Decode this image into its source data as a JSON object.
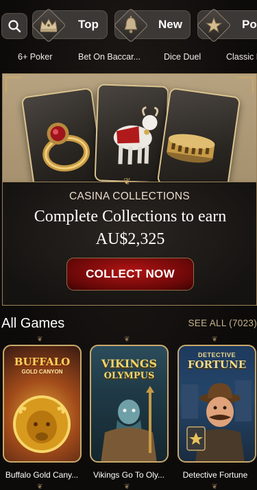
{
  "filters": {
    "search_icon": "search-icon",
    "chips": [
      {
        "label": "Top",
        "icon": "crown-icon"
      },
      {
        "label": "New",
        "icon": "bell-icon"
      },
      {
        "label": "Po",
        "icon": "star-icon"
      }
    ]
  },
  "categories": [
    "6+ Poker",
    "Bet On Baccar...",
    "Dice Duel",
    "Classic P"
  ],
  "banner": {
    "subtitle": "CASINA COLLECTIONS",
    "title": "Complete Collections to earn AU$2,325",
    "button": "COLLECT NOW"
  },
  "games_section": {
    "title": "All Games",
    "see_all": "SEE ALL (7023)",
    "games": [
      {
        "name": "Buffalo Gold Cany...",
        "logo_line1": "BUFFALO",
        "logo_line2": "GOLD CANYON"
      },
      {
        "name": "Vikings Go To Oly...",
        "logo_line1": "VIKINGS",
        "logo_line2": "OLYMPUS"
      },
      {
        "name": "Detective Fortune",
        "logo_line1": "DETECTIVE",
        "logo_line2": "FORTUNE"
      }
    ]
  },
  "colors": {
    "accent_gold": "#c9aa6b",
    "button_red": "#9e1010",
    "background": "#0d0b0a"
  }
}
